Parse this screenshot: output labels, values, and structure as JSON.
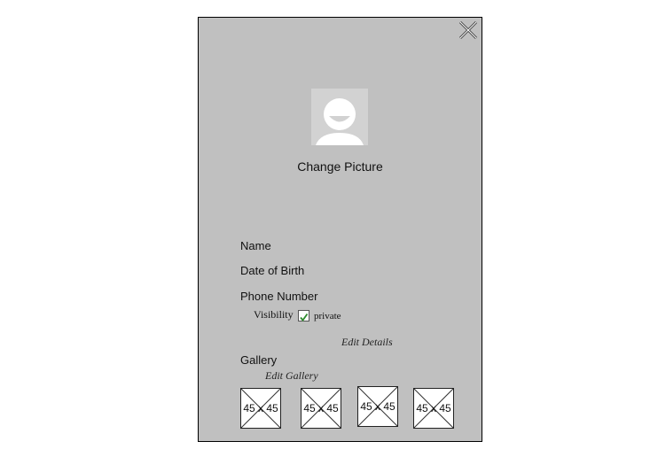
{
  "panel": {
    "close_icon": "close-icon",
    "avatar_icon": "user-avatar-icon",
    "change_picture_label": "Change Picture",
    "fields": {
      "name_label": "Name",
      "dob_label": "Date of Birth",
      "phone_label": "Phone Number"
    },
    "visibility": {
      "label": "Visibility",
      "checked": true,
      "option_label": "private"
    },
    "edit_details_link": "Edit Details",
    "gallery": {
      "label": "Gallery",
      "edit_link": "Edit Gallery",
      "thumbnails": [
        {
          "label": "45 x 45"
        },
        {
          "label": "45 x 45"
        },
        {
          "label": "45 x 45"
        },
        {
          "label": "45 x 45"
        }
      ]
    }
  },
  "colors": {
    "panel_background": "#c0c0c0",
    "checkmark": "#2e8b2e"
  }
}
